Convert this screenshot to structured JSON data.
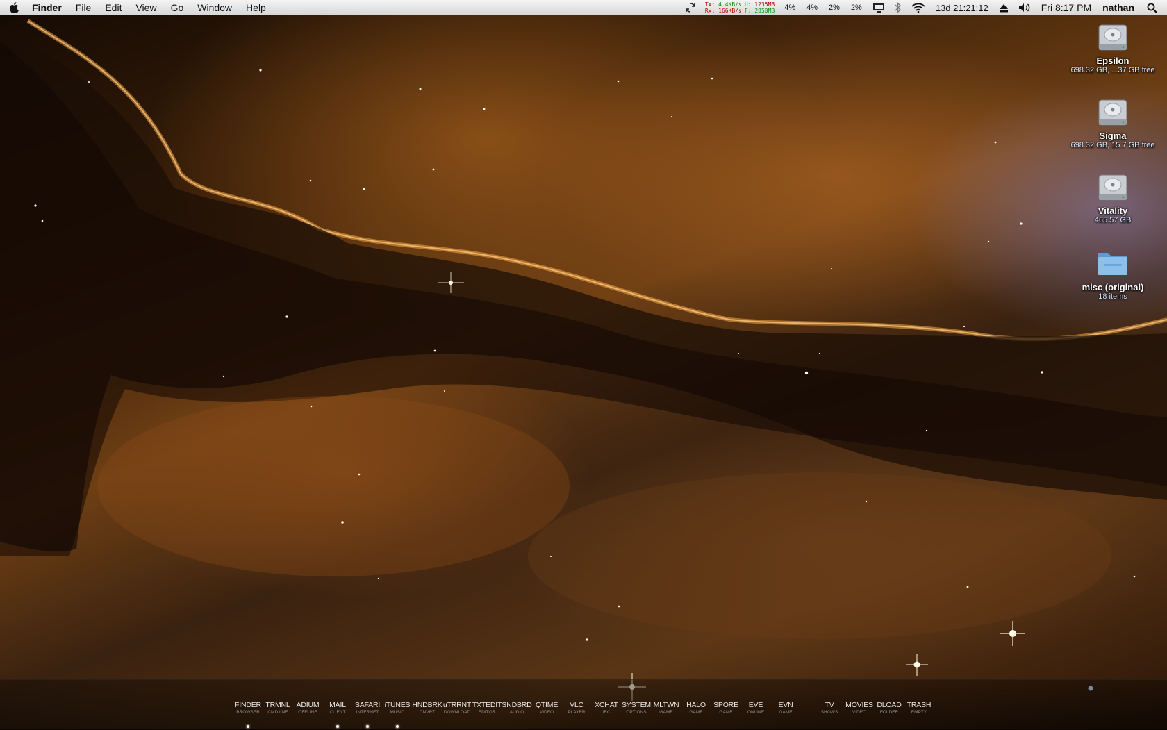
{
  "menubar": {
    "app_name": "Finder",
    "menus": [
      "File",
      "Edit",
      "View",
      "Go",
      "Window",
      "Help"
    ],
    "net": {
      "tx_label": "Tx:",
      "tx_value": "4.4KB/s",
      "rx_label": "Rx:",
      "rx_value": "166KB/s",
      "u_label": "U:",
      "u_value": "1235MB",
      "f_label": "F:",
      "f_value": "2850MB"
    },
    "cpu": [
      "4%",
      "4%",
      "2%",
      "2%"
    ],
    "uptime": "13d 21:21:12",
    "clock": "Fri 8:17 PM",
    "user": "nathan",
    "icons": [
      "sync-icon",
      "display-icon",
      "bluetooth-icon",
      "wifi-icon",
      "eject-icon",
      "volume-icon",
      "spotlight-icon"
    ]
  },
  "desktop": {
    "items": [
      {
        "name": "Epsilon",
        "info": "698.32 GB, ...37 GB free",
        "icon": "hard-drive-icon"
      },
      {
        "name": "Sigma",
        "info": "698.32 GB, 15.7 GB free",
        "icon": "hard-drive-icon"
      },
      {
        "name": "Vitality",
        "info": "465.57 GB",
        "icon": "hard-drive-icon"
      },
      {
        "name": "misc (original)",
        "info": "18 items",
        "icon": "folder-icon"
      }
    ]
  },
  "dock": {
    "items": [
      {
        "label": "FINDER",
        "sub": "BROWSER",
        "running": true
      },
      {
        "label": "TRMNL",
        "sub": "CMD LNE",
        "running": false
      },
      {
        "label": "ADIUM",
        "sub": "OFFLINE",
        "running": false
      },
      {
        "label": "MAIL",
        "sub": "CLIENT",
        "running": true
      },
      {
        "label": "SAFARI",
        "sub": "INTERNET",
        "running": true
      },
      {
        "label": "iTUNES",
        "sub": "MUSIC",
        "running": true
      },
      {
        "label": "HNDBRK",
        "sub": "CNVRT",
        "running": false
      },
      {
        "label": "uTRRNT",
        "sub": "DOWNLOAD",
        "running": false
      },
      {
        "label": "TXTEDIT",
        "sub": "EDITOR",
        "running": false
      },
      {
        "label": "SNDBRD",
        "sub": "AUDIO",
        "running": false
      },
      {
        "label": "QTIME",
        "sub": "VIDEO",
        "running": false
      },
      {
        "label": "VLC",
        "sub": "PLAYER",
        "running": false
      },
      {
        "label": "XCHAT",
        "sub": "IRC",
        "running": false
      },
      {
        "label": "SYSTEM",
        "sub": "OPTIONS",
        "running": false
      },
      {
        "label": "MLTWN",
        "sub": "GAME",
        "running": false
      },
      {
        "label": "HALO",
        "sub": "GAME",
        "running": false
      },
      {
        "label": "SPORE",
        "sub": "GAME",
        "running": false
      },
      {
        "label": "EVE",
        "sub": "ONLINE",
        "running": false
      },
      {
        "label": "EVN",
        "sub": "GAME",
        "running": false
      },
      {
        "label": "TV",
        "sub": "SHOWS",
        "running": false
      },
      {
        "label": "MOVIES",
        "sub": "VIDEO",
        "running": false
      },
      {
        "label": "DLOAD",
        "sub": "FOLDER",
        "running": false
      },
      {
        "label": "TRASH",
        "sub": "EMPTY",
        "running": false
      }
    ]
  }
}
